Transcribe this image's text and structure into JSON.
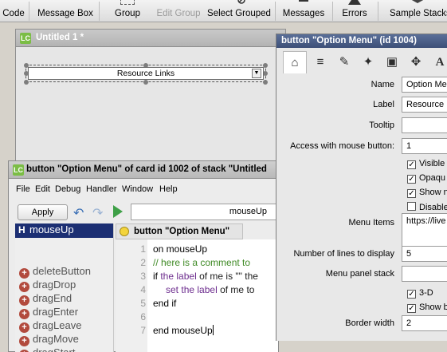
{
  "toolbar": {
    "items": [
      {
        "label": "Code",
        "icon": "code-icon",
        "enabled": true
      },
      {
        "label": "Message Box",
        "icon": "message-box-icon",
        "enabled": true
      },
      {
        "label": "Group",
        "icon": "group-icon",
        "enabled": true
      },
      {
        "label": "Edit Group",
        "icon": "edit-group-icon",
        "enabled": false
      },
      {
        "label": "Select Grouped",
        "icon": "select-grouped-icon",
        "enabled": true
      },
      {
        "label": "Messages",
        "icon": "messages-icon",
        "enabled": true
      },
      {
        "label": "Errors",
        "icon": "errors-icon",
        "enabled": true
      },
      {
        "label": "Sample Stacks",
        "icon": "sample-stacks-icon",
        "enabled": true
      }
    ]
  },
  "stack_window": {
    "title": "Untitled 1 *",
    "app_badge": "LC",
    "button_label": "Resource Links"
  },
  "script_editor": {
    "title": "button \"Option Menu\" of card id 1002 of stack \"Untitled",
    "app_badge": "LC",
    "menu": [
      "File",
      "Edit",
      "Debug",
      "Handler",
      "Window",
      "Help"
    ],
    "apply_label": "Apply",
    "handler_field": "mouseUp",
    "handler_list": {
      "selected_prefix": "H",
      "selected": "mouseUp",
      "items": [
        "deleteButton",
        "dragDrop",
        "dragEnd",
        "dragEnter",
        "dragLeave",
        "dragMove",
        "dragStart"
      ]
    },
    "tab_label": "button \"Option Menu\"",
    "line_numbers": [
      "1",
      "2",
      "3",
      "4",
      "5",
      "6",
      "7"
    ],
    "code": {
      "l1": "on mouseUp",
      "l2": "// here is a comment to",
      "l3a": "if",
      "l3b": "the",
      "l3c": "label",
      "l3d": "of me is \"\" the",
      "l4a": "set",
      "l4b": "the",
      "l4c": "label",
      "l4d": "of me to",
      "l5": "end if",
      "l7": "end mouseUp"
    }
  },
  "inspector": {
    "title": "button \"Option Menu\" (id 1004)",
    "tabs": [
      "home-icon",
      "database-icon",
      "pencil-icon",
      "magic-wand-icon",
      "image-icon",
      "move-icon",
      "text-icon"
    ],
    "fields": {
      "name_label": "Name",
      "name_value": "Option Me",
      "label_label": "Label",
      "label_value": "Resource L",
      "tooltip_label": "Tooltip",
      "tooltip_value": "",
      "access_label": "Access with mouse button:",
      "access_value": "1",
      "visible_label": "Visible",
      "opaque_label": "Opaqu",
      "show_name_label": "Show n",
      "disabled_label": "Disable",
      "menu_items_label": "Menu Items",
      "menu_items_value": "https://live",
      "lines_label": "Number of lines to display",
      "lines_value": "5",
      "panel_label": "Menu panel stack",
      "panel_value": "",
      "threed_label": "3-D",
      "show_border_label": "Show b",
      "border_label": "Border width",
      "border_value": "2"
    },
    "checks": {
      "visible": true,
      "opaque": true,
      "show_name": true,
      "disabled": false,
      "three_d": true,
      "show_border": true
    }
  }
}
